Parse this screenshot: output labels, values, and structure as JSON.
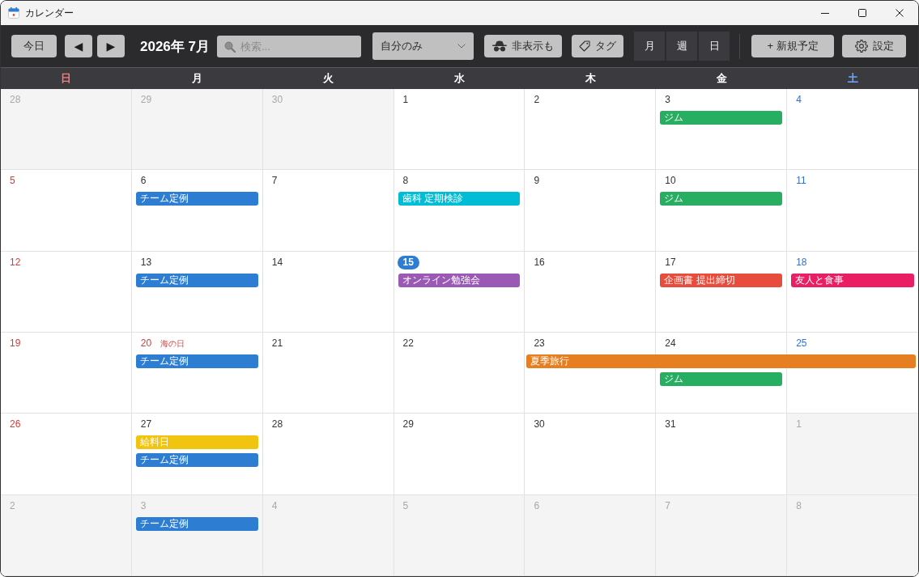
{
  "window": {
    "title": "カレンダー"
  },
  "toolbar": {
    "today_button": "今日",
    "prev_button": "◀",
    "next_button": "▶",
    "month_title": "2026年 7月",
    "search": {
      "placeholder": "検索..."
    },
    "filter_dropdown": {
      "value": "自分のみ"
    },
    "show_hidden_button": "非表示も",
    "tag_button": "タグ",
    "view_tabs": [
      "月",
      "週",
      "日"
    ],
    "new_event_button": "+ 新規予定",
    "settings_button": "設定"
  },
  "weekdays": [
    {
      "label": "日",
      "kind": "sunday"
    },
    {
      "label": "月",
      "kind": "weekday"
    },
    {
      "label": "火",
      "kind": "weekday"
    },
    {
      "label": "水",
      "kind": "weekday"
    },
    {
      "label": "木",
      "kind": "weekday"
    },
    {
      "label": "金",
      "kind": "weekday"
    },
    {
      "label": "土",
      "kind": "saturday"
    }
  ],
  "weeks": [
    {
      "days": [
        {
          "date": "28",
          "in_month": false,
          "today": false
        },
        {
          "date": "29",
          "in_month": false,
          "today": false
        },
        {
          "date": "30",
          "in_month": false,
          "today": false
        },
        {
          "date": "1",
          "in_month": true,
          "today": false
        },
        {
          "date": "2",
          "in_month": true,
          "today": false
        },
        {
          "date": "3",
          "in_month": true,
          "today": false,
          "events": [
            {
              "kind": "single",
              "title": "ジム",
              "color": "#27ae60"
            }
          ]
        },
        {
          "date": "4",
          "in_month": true,
          "today": false
        }
      ]
    },
    {
      "days": [
        {
          "date": "5",
          "in_month": true,
          "today": false
        },
        {
          "date": "6",
          "in_month": true,
          "today": false,
          "events": [
            {
              "kind": "single",
              "title": "チーム定例",
              "color": "#2d7dd2"
            }
          ]
        },
        {
          "date": "7",
          "in_month": true,
          "today": false
        },
        {
          "date": "8",
          "in_month": true,
          "today": false,
          "events": [
            {
              "kind": "single",
              "title": "歯科 定期検診",
              "color": "#00bcd4"
            }
          ]
        },
        {
          "date": "9",
          "in_month": true,
          "today": false
        },
        {
          "date": "10",
          "in_month": true,
          "today": false,
          "events": [
            {
              "kind": "single",
              "title": "ジム",
              "color": "#27ae60"
            }
          ]
        },
        {
          "date": "11",
          "in_month": true,
          "today": false
        }
      ]
    },
    {
      "days": [
        {
          "date": "12",
          "in_month": true,
          "today": false
        },
        {
          "date": "13",
          "in_month": true,
          "today": false,
          "events": [
            {
              "kind": "single",
              "title": "チーム定例",
              "color": "#2d7dd2"
            }
          ]
        },
        {
          "date": "14",
          "in_month": true,
          "today": false
        },
        {
          "date": "15",
          "in_month": true,
          "today": true,
          "events": [
            {
              "kind": "single",
              "title": "オンライン勉強会",
              "color": "#9b59b6"
            }
          ]
        },
        {
          "date": "16",
          "in_month": true,
          "today": false
        },
        {
          "date": "17",
          "in_month": true,
          "today": false,
          "events": [
            {
              "kind": "single",
              "title": "企画書 提出締切",
              "color": "#e74c3c"
            }
          ]
        },
        {
          "date": "18",
          "in_month": true,
          "today": false,
          "events": [
            {
              "kind": "single",
              "title": "友人と食事",
              "color": "#e91e63"
            }
          ]
        }
      ]
    },
    {
      "days": [
        {
          "date": "19",
          "in_month": true,
          "today": false
        },
        {
          "date": "20",
          "in_month": true,
          "today": false,
          "holiday": "海の日",
          "events": [
            {
              "kind": "single",
              "title": "チーム定例",
              "color": "#2d7dd2"
            }
          ]
        },
        {
          "date": "21",
          "in_month": true,
          "today": false
        },
        {
          "date": "22",
          "in_month": true,
          "today": false
        },
        {
          "date": "23",
          "in_month": true,
          "today": false,
          "events": [
            {
              "kind": "span",
              "title": "夏季旅行",
              "color": "#e67e22"
            }
          ]
        },
        {
          "date": "24",
          "in_month": true,
          "today": false,
          "events": [
            {
              "kind": "continued"
            },
            {
              "kind": "single",
              "title": "ジム",
              "color": "#27ae60"
            }
          ]
        },
        {
          "date": "25",
          "in_month": true,
          "today": false,
          "events": [
            {
              "kind": "continued"
            }
          ]
        }
      ]
    },
    {
      "days": [
        {
          "date": "26",
          "in_month": true,
          "today": false
        },
        {
          "date": "27",
          "in_month": true,
          "today": false,
          "events": [
            {
              "kind": "single",
              "title": "給料日",
              "color": "#f1c40f"
            },
            {
              "kind": "single",
              "title": "チーム定例",
              "color": "#2d7dd2"
            }
          ]
        },
        {
          "date": "28",
          "in_month": true,
          "today": false
        },
        {
          "date": "29",
          "in_month": true,
          "today": false
        },
        {
          "date": "30",
          "in_month": true,
          "today": false
        },
        {
          "date": "31",
          "in_month": true,
          "today": false
        },
        {
          "date": "1",
          "in_month": false,
          "today": false
        }
      ]
    },
    {
      "days": [
        {
          "date": "2",
          "in_month": false,
          "today": false
        },
        {
          "date": "3",
          "in_month": false,
          "today": false,
          "events": [
            {
              "kind": "single",
              "title": "チーム定例",
              "color": "#2d7dd2"
            }
          ]
        },
        {
          "date": "4",
          "in_month": false,
          "today": false
        },
        {
          "date": "5",
          "in_month": false,
          "today": false
        },
        {
          "date": "6",
          "in_month": false,
          "today": false
        },
        {
          "date": "7",
          "in_month": false,
          "today": false
        },
        {
          "date": "8",
          "in_month": false,
          "today": false
        }
      ]
    }
  ]
}
